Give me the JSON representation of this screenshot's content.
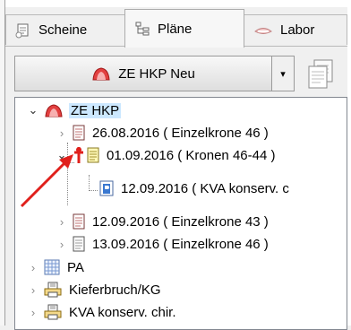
{
  "tabs": [
    {
      "label": "Scheine",
      "icon": "scheine-icon"
    },
    {
      "label": "Pläne",
      "icon": "plaene-icon"
    },
    {
      "label": "Labor",
      "icon": "labor-icon"
    }
  ],
  "toolbar": {
    "dropdown_value": "ZE HKP Neu",
    "dropdown_arrow": "▾"
  },
  "tree": {
    "root": {
      "label": "ZE HKP",
      "expander": "⌄"
    },
    "items": [
      {
        "label": "26.08.2016 ( Einzelkrone 46 )"
      },
      {
        "label": "01.09.2016 ( Kronen 46-44 )"
      },
      {
        "label": "12.09.2016 ( KVA konserv. c"
      },
      {
        "label": "12.09.2016 ( Einzelkrone 43 )"
      },
      {
        "label": "13.09.2016 ( Einzelkrone 46 )"
      }
    ],
    "groups": [
      {
        "label": "PA"
      },
      {
        "label": "Kieferbruch/KG"
      },
      {
        "label": "KVA konserv. chir."
      }
    ]
  },
  "colors": {
    "selected_bg": "#cce8ff",
    "annotation_arrow": "#e0201c",
    "tooth_red": "#e0201c"
  }
}
